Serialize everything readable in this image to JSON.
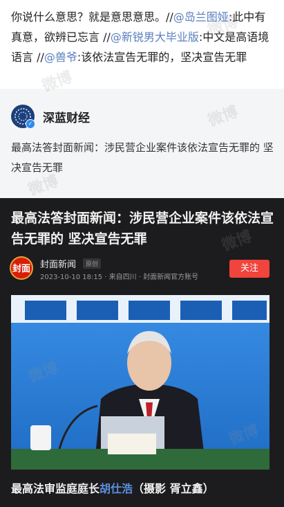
{
  "comment": {
    "part1": "你说什么意思？就是意思意思。//",
    "mention1": "@岛兰图娅",
    "part2": ":此中有真意，欲辨已忘言 //",
    "mention2": "@新锐男大毕业版",
    "part3": ":中文是高语境语言 //",
    "mention3": "@兽爷",
    "part4": ":该依法宣告无罪的，坚决宣告无罪"
  },
  "repost": {
    "author": "深蓝财经",
    "text": "最高法答封面新闻：涉民营企业案件该依法宣告无罪的 坚决宣告无罪"
  },
  "article": {
    "title": "最高法答封面新闻：涉民营企业案件该依法宣告无罪的 坚决宣告无罪",
    "source_name": "封面新闻",
    "source_badge": "原创",
    "source_logo_text": "封面",
    "meta": "2023-10-10 18:15 · 来自四川 · 封面新闻官方账号",
    "follow_label": "关注",
    "caption_prefix": "最高法审监庭庭长",
    "caption_name": "胡仕浩",
    "caption_suffix": "（摄影 胥立鑫）"
  },
  "watermark": "微博",
  "colors": {
    "mention": "#5a7fbf",
    "follow": "#f0443c",
    "card_bg": "#1c1c1e"
  }
}
